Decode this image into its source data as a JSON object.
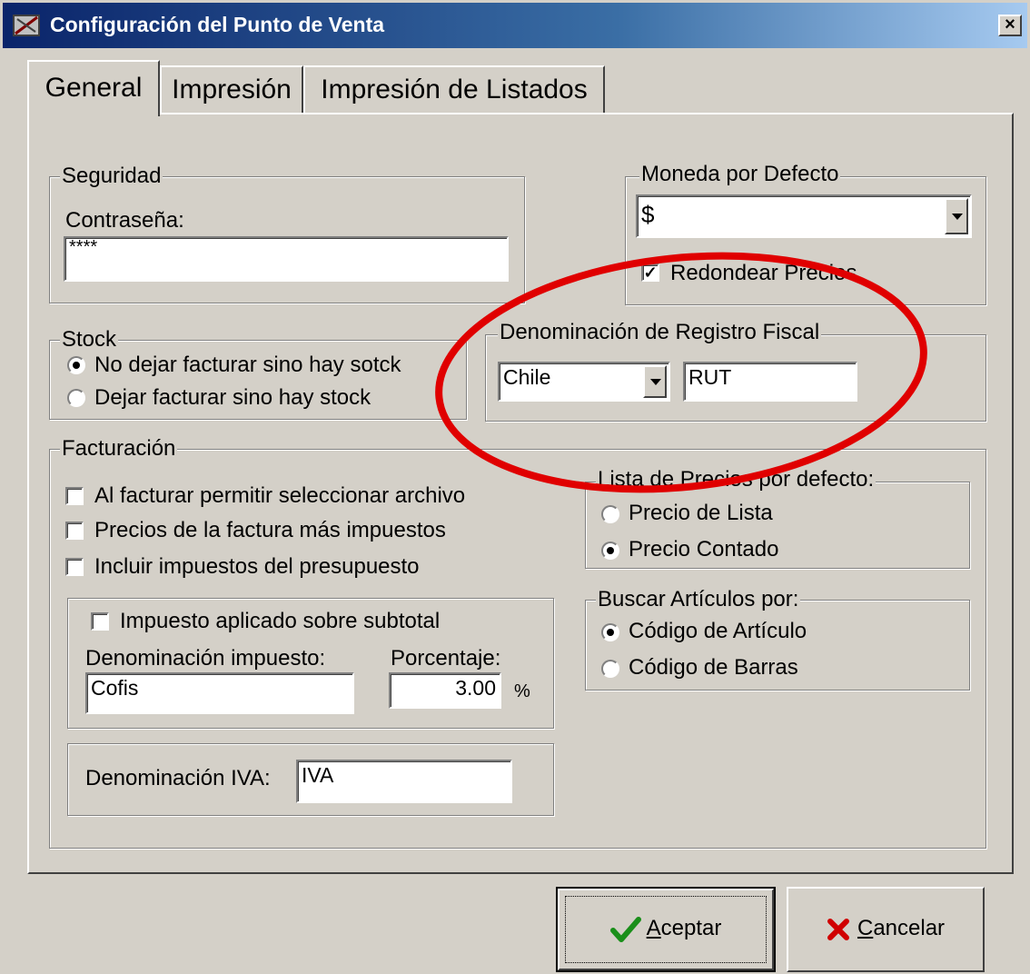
{
  "window": {
    "title": "Configuración del Punto de Venta",
    "close_glyph": "×"
  },
  "tabs": [
    {
      "label": "General",
      "active": true
    },
    {
      "label": "Impresión",
      "active": false
    },
    {
      "label": "Impresión de Listados",
      "active": false
    }
  ],
  "seguridad": {
    "legend": "Seguridad",
    "password_label": "Contraseña:",
    "password_value": "****"
  },
  "moneda": {
    "legend": "Moneda por Defecto",
    "selected": "$",
    "round_prices_label": "Redondear Precios",
    "round_prices_checked": true,
    "check_glyph": "✓"
  },
  "stock": {
    "legend": "Stock",
    "options": [
      {
        "label": "No dejar facturar sino hay sotck",
        "selected": true
      },
      {
        "label": "Dejar facturar sino hay stock",
        "selected": false
      }
    ]
  },
  "registro_fiscal": {
    "legend": "Denominación de Registro Fiscal",
    "country": "Chile",
    "denomination": "RUT"
  },
  "facturacion": {
    "legend": "Facturación",
    "checks": [
      {
        "label": "Al facturar permitir seleccionar archivo",
        "checked": false
      },
      {
        "label": "Precios de la factura más impuestos",
        "checked": false
      },
      {
        "label": "Incluir impuestos del presupuesto",
        "checked": false
      }
    ],
    "impuesto": {
      "check_label": "Impuesto aplicado sobre subtotal",
      "checked": false,
      "denom_label": "Denominación impuesto:",
      "denom_value": "Cofis",
      "percent_label": "Porcentaje:",
      "percent_value": "3.00",
      "percent_sign": "%"
    },
    "iva": {
      "label": "Denominación IVA:",
      "value": "IVA"
    }
  },
  "lista_precios": {
    "legend": "Lista de Precios por defecto:",
    "options": [
      {
        "label": "Precio de Lista",
        "selected": false
      },
      {
        "label": "Precio Contado",
        "selected": true
      }
    ]
  },
  "buscar": {
    "legend": "Buscar Artículos por:",
    "options": [
      {
        "label": "Código de Artículo",
        "selected": true
      },
      {
        "label": "Código de Barras",
        "selected": false
      }
    ]
  },
  "buttons": {
    "accept": {
      "mnemonic": "A",
      "rest": "ceptar"
    },
    "cancel": {
      "mnemonic": "C",
      "rest": "ancelar"
    }
  },
  "colors": {
    "annotation": "#e00000",
    "title_start": "#0a246a",
    "title_end": "#a6caf0",
    "face": "#d4d0c8"
  }
}
